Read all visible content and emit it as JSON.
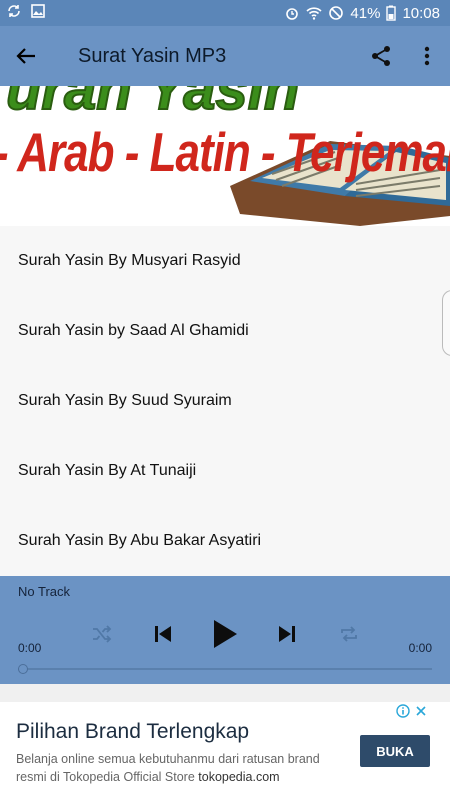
{
  "status": {
    "battery": "41%",
    "time": "10:08"
  },
  "app": {
    "title": "Surat Yasin MP3"
  },
  "banner": {
    "top_text": "urah Yasin",
    "subtitle": "- Arab - Latin - Terjemahan"
  },
  "tracks": [
    "Surah Yasin By Musyari Rasyid",
    "Surah Yasin by Saad Al Ghamidi",
    "Surah Yasin By Suud Syuraim",
    "Surah Yasin By At Tunaiji",
    "Surah Yasin By Abu Bakar Asyatiri"
  ],
  "player": {
    "track_name": "No Track",
    "elapsed": "0:00",
    "duration": "0:00",
    "progress": 0
  },
  "ad": {
    "title": "Pilihan Brand Terlengkap",
    "description": "Belanja online semua kebutuhanmu dari ratusan brand resmi di Tokopedia Official Store",
    "domain": "tokopedia.com",
    "button_label": "BUKA"
  },
  "colors": {
    "status_bar": "#5b86b8",
    "app_bar": "#6b93c4",
    "player": "#6b93c4",
    "ad_button": "#2e4b6a"
  }
}
